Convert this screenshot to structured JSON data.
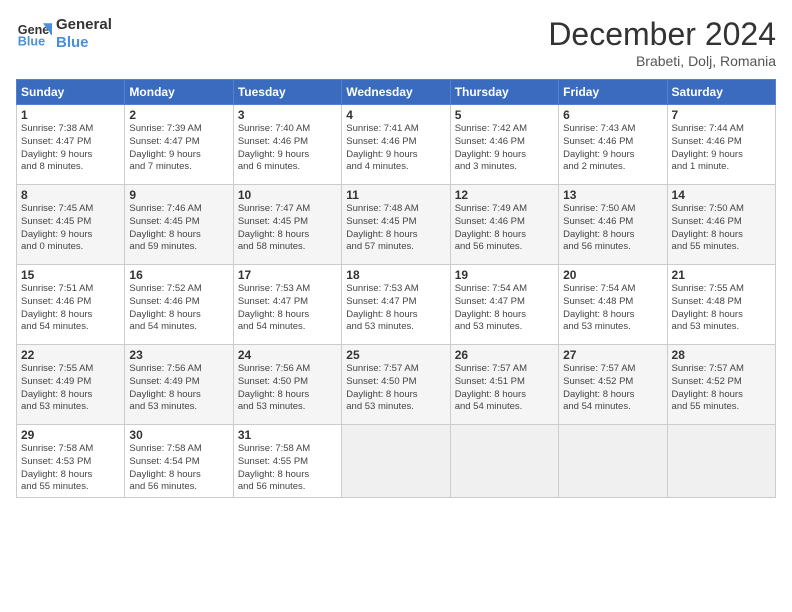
{
  "header": {
    "logo_line1": "General",
    "logo_line2": "Blue",
    "month": "December 2024",
    "location": "Brabeti, Dolj, Romania"
  },
  "days_of_week": [
    "Sunday",
    "Monday",
    "Tuesday",
    "Wednesday",
    "Thursday",
    "Friday",
    "Saturday"
  ],
  "weeks": [
    [
      {
        "day": "1",
        "info": "Sunrise: 7:38 AM\nSunset: 4:47 PM\nDaylight: 9 hours\nand 8 minutes."
      },
      {
        "day": "2",
        "info": "Sunrise: 7:39 AM\nSunset: 4:47 PM\nDaylight: 9 hours\nand 7 minutes."
      },
      {
        "day": "3",
        "info": "Sunrise: 7:40 AM\nSunset: 4:46 PM\nDaylight: 9 hours\nand 6 minutes."
      },
      {
        "day": "4",
        "info": "Sunrise: 7:41 AM\nSunset: 4:46 PM\nDaylight: 9 hours\nand 4 minutes."
      },
      {
        "day": "5",
        "info": "Sunrise: 7:42 AM\nSunset: 4:46 PM\nDaylight: 9 hours\nand 3 minutes."
      },
      {
        "day": "6",
        "info": "Sunrise: 7:43 AM\nSunset: 4:46 PM\nDaylight: 9 hours\nand 2 minutes."
      },
      {
        "day": "7",
        "info": "Sunrise: 7:44 AM\nSunset: 4:46 PM\nDaylight: 9 hours\nand 1 minute."
      }
    ],
    [
      {
        "day": "8",
        "info": "Sunrise: 7:45 AM\nSunset: 4:45 PM\nDaylight: 9 hours\nand 0 minutes."
      },
      {
        "day": "9",
        "info": "Sunrise: 7:46 AM\nSunset: 4:45 PM\nDaylight: 8 hours\nand 59 minutes."
      },
      {
        "day": "10",
        "info": "Sunrise: 7:47 AM\nSunset: 4:45 PM\nDaylight: 8 hours\nand 58 minutes."
      },
      {
        "day": "11",
        "info": "Sunrise: 7:48 AM\nSunset: 4:45 PM\nDaylight: 8 hours\nand 57 minutes."
      },
      {
        "day": "12",
        "info": "Sunrise: 7:49 AM\nSunset: 4:46 PM\nDaylight: 8 hours\nand 56 minutes."
      },
      {
        "day": "13",
        "info": "Sunrise: 7:50 AM\nSunset: 4:46 PM\nDaylight: 8 hours\nand 56 minutes."
      },
      {
        "day": "14",
        "info": "Sunrise: 7:50 AM\nSunset: 4:46 PM\nDaylight: 8 hours\nand 55 minutes."
      }
    ],
    [
      {
        "day": "15",
        "info": "Sunrise: 7:51 AM\nSunset: 4:46 PM\nDaylight: 8 hours\nand 54 minutes."
      },
      {
        "day": "16",
        "info": "Sunrise: 7:52 AM\nSunset: 4:46 PM\nDaylight: 8 hours\nand 54 minutes."
      },
      {
        "day": "17",
        "info": "Sunrise: 7:53 AM\nSunset: 4:47 PM\nDaylight: 8 hours\nand 54 minutes."
      },
      {
        "day": "18",
        "info": "Sunrise: 7:53 AM\nSunset: 4:47 PM\nDaylight: 8 hours\nand 53 minutes."
      },
      {
        "day": "19",
        "info": "Sunrise: 7:54 AM\nSunset: 4:47 PM\nDaylight: 8 hours\nand 53 minutes."
      },
      {
        "day": "20",
        "info": "Sunrise: 7:54 AM\nSunset: 4:48 PM\nDaylight: 8 hours\nand 53 minutes."
      },
      {
        "day": "21",
        "info": "Sunrise: 7:55 AM\nSunset: 4:48 PM\nDaylight: 8 hours\nand 53 minutes."
      }
    ],
    [
      {
        "day": "22",
        "info": "Sunrise: 7:55 AM\nSunset: 4:49 PM\nDaylight: 8 hours\nand 53 minutes."
      },
      {
        "day": "23",
        "info": "Sunrise: 7:56 AM\nSunset: 4:49 PM\nDaylight: 8 hours\nand 53 minutes."
      },
      {
        "day": "24",
        "info": "Sunrise: 7:56 AM\nSunset: 4:50 PM\nDaylight: 8 hours\nand 53 minutes."
      },
      {
        "day": "25",
        "info": "Sunrise: 7:57 AM\nSunset: 4:50 PM\nDaylight: 8 hours\nand 53 minutes."
      },
      {
        "day": "26",
        "info": "Sunrise: 7:57 AM\nSunset: 4:51 PM\nDaylight: 8 hours\nand 54 minutes."
      },
      {
        "day": "27",
        "info": "Sunrise: 7:57 AM\nSunset: 4:52 PM\nDaylight: 8 hours\nand 54 minutes."
      },
      {
        "day": "28",
        "info": "Sunrise: 7:57 AM\nSunset: 4:52 PM\nDaylight: 8 hours\nand 55 minutes."
      }
    ],
    [
      {
        "day": "29",
        "info": "Sunrise: 7:58 AM\nSunset: 4:53 PM\nDaylight: 8 hours\nand 55 minutes."
      },
      {
        "day": "30",
        "info": "Sunrise: 7:58 AM\nSunset: 4:54 PM\nDaylight: 8 hours\nand 56 minutes."
      },
      {
        "day": "31",
        "info": "Sunrise: 7:58 AM\nSunset: 4:55 PM\nDaylight: 8 hours\nand 56 minutes."
      },
      {
        "day": "",
        "info": ""
      },
      {
        "day": "",
        "info": ""
      },
      {
        "day": "",
        "info": ""
      },
      {
        "day": "",
        "info": ""
      }
    ]
  ]
}
